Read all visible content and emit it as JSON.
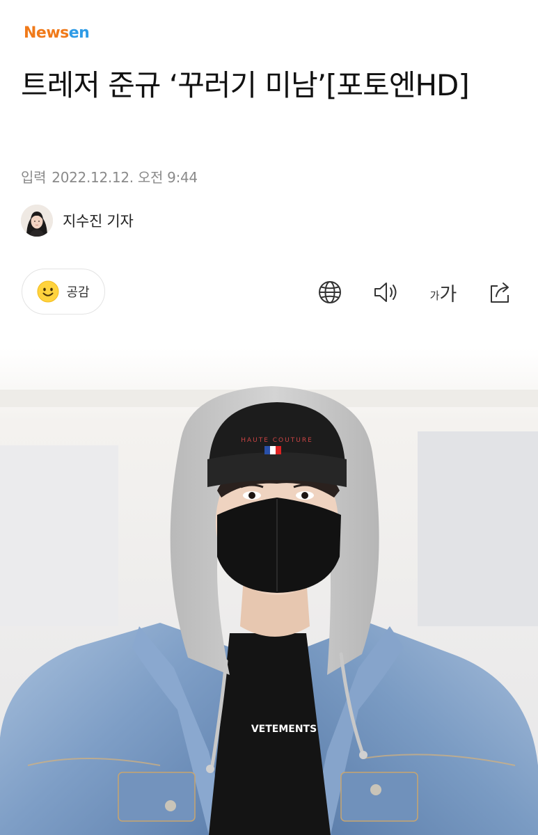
{
  "header": {
    "logo_part1": "News",
    "logo_part2": "en",
    "logo_colors": {
      "news": "#f07a1a",
      "en": "#2e9be6"
    }
  },
  "article": {
    "headline": "트레저 준규 ‘꾸러기 미남’[포토엔HD]",
    "date_label": "입력",
    "date_value": "2022.12.12. 오전 9:44",
    "reporter_name": "지수진 기자"
  },
  "actions": {
    "empathy_label": "공감",
    "empathy_icon": "smile-icon",
    "translate_icon": "globe-icon",
    "read_aloud_icon": "speaker-icon",
    "font_small": "가",
    "font_large": "가",
    "font_icon": "font-size-icon",
    "share_icon": "share-icon"
  },
  "photo": {
    "shirt_text": "VETEMENTS",
    "beanie_text": "HAUTE COUTURE"
  }
}
